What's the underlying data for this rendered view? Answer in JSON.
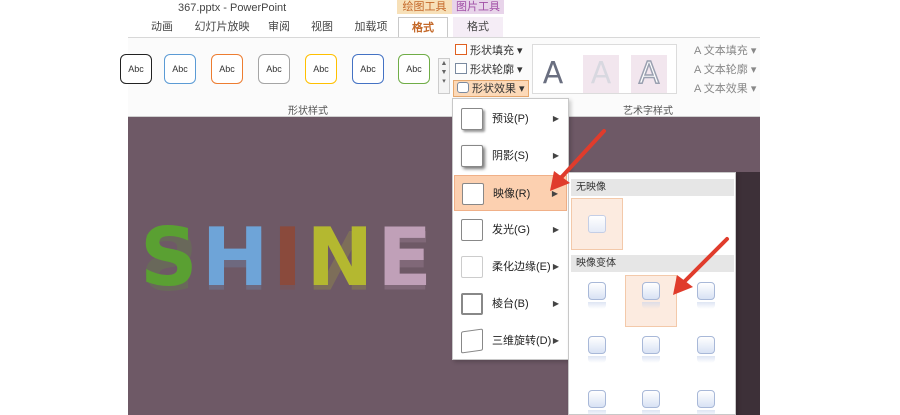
{
  "window": {
    "title": "367.pptx - PowerPoint",
    "context_group_drawing": "绘图工具",
    "context_group_picture": "图片工具"
  },
  "tabs": [
    {
      "label": "动画"
    },
    {
      "label": "幻灯片放映"
    },
    {
      "label": "审阅"
    },
    {
      "label": "视图"
    },
    {
      "label": "加载项"
    },
    {
      "label": "格式",
      "active": true
    },
    {
      "label": "格式"
    }
  ],
  "ribbon": {
    "shape_styles_group": "形状样式",
    "wordart_group": "艺术字样式",
    "shape_style_thumbs": [
      "Abc",
      "Abc",
      "Abc",
      "Abc",
      "Abc",
      "Abc",
      "Abc"
    ],
    "shape_fill": "形状填充",
    "shape_outline": "形状轮廓",
    "shape_effects": "形状效果",
    "text_fill": "文本填充",
    "text_outline": "文本轮廓",
    "text_effects": "文本效果",
    "wordart_letters": [
      "A",
      "A",
      "A"
    ]
  },
  "slide": {
    "word_letters": [
      "S",
      "H",
      "I",
      "N",
      "E"
    ]
  },
  "menu": {
    "items": [
      {
        "label": "预设(P)"
      },
      {
        "label": "阴影(S)"
      },
      {
        "label": "映像(R)"
      },
      {
        "label": "发光(G)"
      },
      {
        "label": "柔化边缘(E)"
      },
      {
        "label": "棱台(B)"
      },
      {
        "label": "三维旋转(D)"
      }
    ]
  },
  "submenu": {
    "no_reflection": "无映像",
    "reflection_variations": "映像变体"
  },
  "colors": {
    "accent_orange": "#c4692a",
    "hover_bg": "#fcd0b0",
    "slide_bg": "#6e5966",
    "arrow_red": "#e03c2c"
  }
}
